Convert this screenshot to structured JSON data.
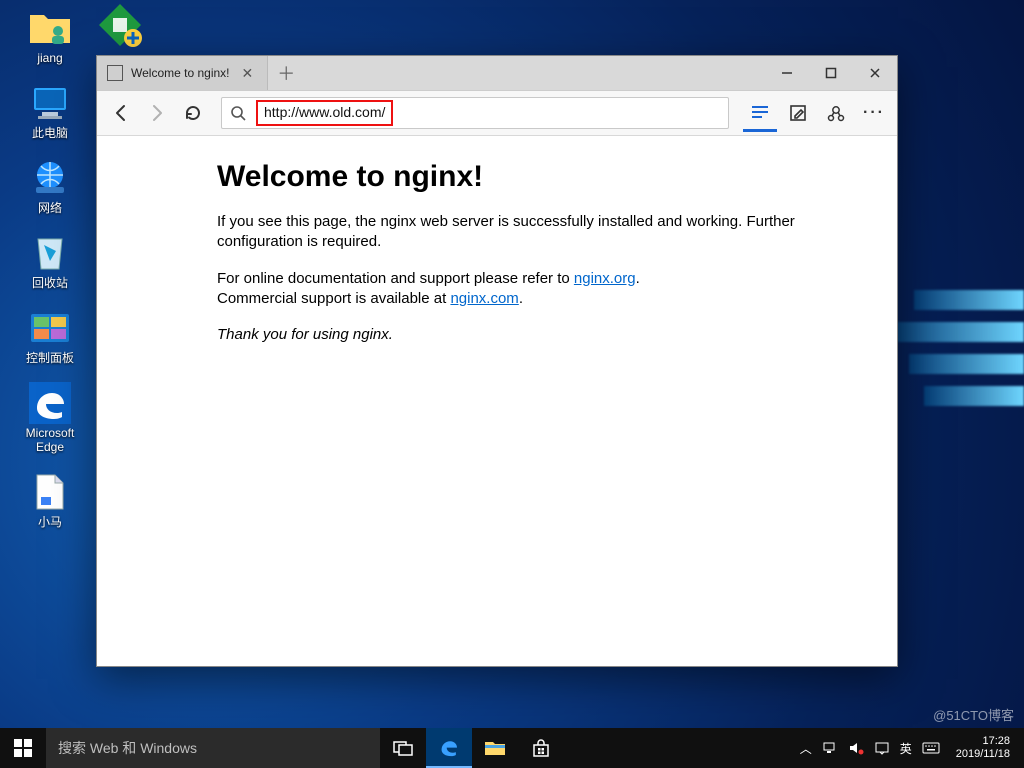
{
  "desktop": {
    "icons": [
      {
        "name": "user-folder",
        "label": "jiang"
      },
      {
        "name": "this-pc",
        "label": "此电脑"
      },
      {
        "name": "network",
        "label": "网络"
      },
      {
        "name": "recycle-bin",
        "label": "回收站"
      },
      {
        "name": "control-panel",
        "label": "控制面板"
      },
      {
        "name": "edge-shortcut",
        "label": "Microsoft\nEdge"
      },
      {
        "name": "text-file",
        "label": "小马"
      }
    ]
  },
  "browser": {
    "tab_title": "Welcome to nginx!",
    "url": "http://www.old.com/",
    "page": {
      "heading": "Welcome to nginx!",
      "p1a": "If you see this page, the nginx web server is successfully installed and working. Further configuration is required.",
      "p2a": "For online documentation and support please refer to ",
      "link1": "nginx.org",
      "p2b": ".",
      "p3a": "Commercial support is available at ",
      "link2": "nginx.com",
      "p3b": ".",
      "thanks": "Thank you for using nginx."
    }
  },
  "taskbar": {
    "search_placeholder": "搜索 Web 和 Windows",
    "time": "17:28",
    "date": "2019/11/18"
  },
  "watermark": "@51CTO博客"
}
